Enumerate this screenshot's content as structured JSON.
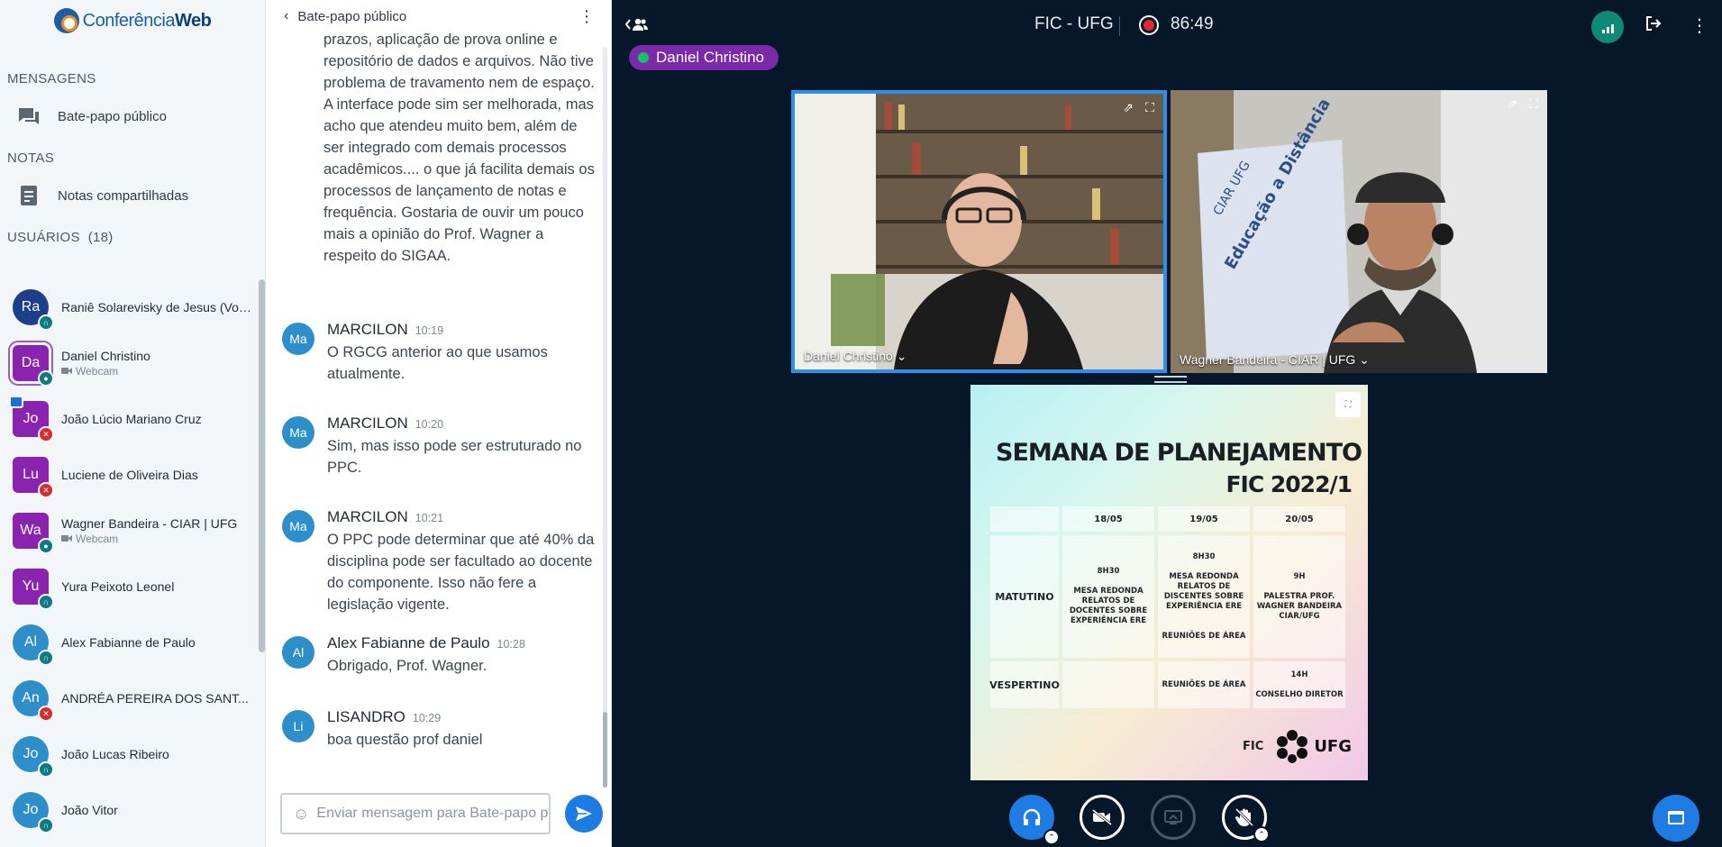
{
  "app": {
    "logo_text_a": "Conferência",
    "logo_text_b": "Web"
  },
  "sidebar": {
    "messages_title": "MENSAGENS",
    "public_chat_label": "Bate-papo público",
    "notes_title": "NOTAS",
    "shared_notes_label": "Notas compartilhadas",
    "users_title": "USUÁRIOS",
    "users_count": "(18)",
    "users": [
      {
        "initials": "Ra",
        "name": "Raniê Solarevisky de Jesus (Você)",
        "sub": "",
        "color": "#1d3f8a",
        "status": "listen"
      },
      {
        "initials": "Da",
        "name": "Daniel Christino",
        "sub": "Webcam",
        "color": "#8a24b0",
        "status": "on"
      },
      {
        "initials": "Jo",
        "name": "João Lúcio Mariano Cruz",
        "sub": "",
        "color": "#8a24b0",
        "status": "muted"
      },
      {
        "initials": "Lu",
        "name": "Luciene de Oliveira Dias",
        "sub": "",
        "color": "#8a24b0",
        "status": "muted"
      },
      {
        "initials": "Wa",
        "name": "Wagner Bandeira - CIAR | UFG",
        "sub": "Webcam",
        "color": "#8a24b0",
        "status": "on"
      },
      {
        "initials": "Yu",
        "name": "Yura Peixoto Leonel",
        "sub": "",
        "color": "#8a24b0",
        "status": "listen"
      },
      {
        "initials": "Al",
        "name": "Alex Fabianne de Paulo",
        "sub": "",
        "color": "#2d8ec9",
        "status": "listen"
      },
      {
        "initials": "An",
        "name": "ANDRÉA PEREIRA DOS SANT...",
        "sub": "",
        "color": "#2d8ec9",
        "status": "muted"
      },
      {
        "initials": "Jo",
        "name": "João Lucas Ribeiro",
        "sub": "",
        "color": "#2d8ec9",
        "status": "listen"
      },
      {
        "initials": "Jo",
        "name": "João Vitor",
        "sub": "",
        "color": "#2d8ec9",
        "status": "listen"
      }
    ]
  },
  "chat": {
    "title": "Bate-papo público",
    "partial_message": "prazos, aplicação de prova online e repositório de dados e arquivos. Não tive problema de travamento nem de espaço. A interface pode sim ser melhorada, mas acho que atendeu muito bem, além de ser integrado com demais processos acadêmicos.... o que já facilita demais os processos de lançamento de notas e frequência. Gostaria de ouvir um pouco mais a opinião do Prof. Wagner a respeito do SIGAA.",
    "messages": [
      {
        "initials": "Ma",
        "author": "MARCILON",
        "time": "10:19",
        "text": "O RGCG anterior ao que usamos atualmente."
      },
      {
        "initials": "Ma",
        "author": "MARCILON",
        "time": "10:20",
        "text": "Sim, mas isso pode ser estruturado no PPC."
      },
      {
        "initials": "Ma",
        "author": "MARCILON",
        "time": "10:21",
        "text": "O PPC pode determinar que até 40% da disciplina pode ser facultado ao docente do componente. Isso não fere a legislação vigente."
      },
      {
        "initials": "Al",
        "author": "Alex Fabianne de Paulo",
        "time": "10:28",
        "text": "Obrigado, Prof. Wagner."
      },
      {
        "initials": "Li",
        "author": "LISANDRO",
        "time": "10:29",
        "text": "boa questão prof daniel"
      }
    ],
    "input_placeholder": "Enviar mensagem para Bate-papo público"
  },
  "stage": {
    "meeting_title": "FIC - UFG",
    "recording_time": "86:49",
    "talking_indicator": "Daniel Christino",
    "videos": [
      {
        "name": "Daniel Christino"
      },
      {
        "name": "Wagner Bandeira - CIAR | UFG"
      }
    ]
  },
  "slide": {
    "title": "SEMANA DE PLANEJAMENTO",
    "subtitle": "FIC 2022/1",
    "dates": [
      "18/05",
      "19/05",
      "20/05"
    ],
    "matutino_label": "MATUTINO",
    "vespertino_label": "VESPERTINO",
    "mat_cells": [
      {
        "time": "8H30",
        "text": "MESA REDONDA RELATOS DE DOCENTES SOBRE EXPERIÊNCIA ERE",
        "extra": ""
      },
      {
        "time": "8H30",
        "text": "MESA REDONDA RELATOS DE DISCENTES SOBRE EXPERIÊNCIA ERE",
        "extra": "REUNIÕES DE ÁREA"
      },
      {
        "time": "9H",
        "text": "PALESTRA PROF. WAGNER BANDEIRA CIAR/UFG",
        "extra": ""
      }
    ],
    "ves_cells": [
      {
        "time": "",
        "text": ""
      },
      {
        "time": "",
        "text": "REUNIÕES DE ÁREA"
      },
      {
        "time": "14H",
        "text": "CONSELHO DIRETOR"
      }
    ],
    "logo_fic": "FIC",
    "logo_ufg": "UFG"
  }
}
